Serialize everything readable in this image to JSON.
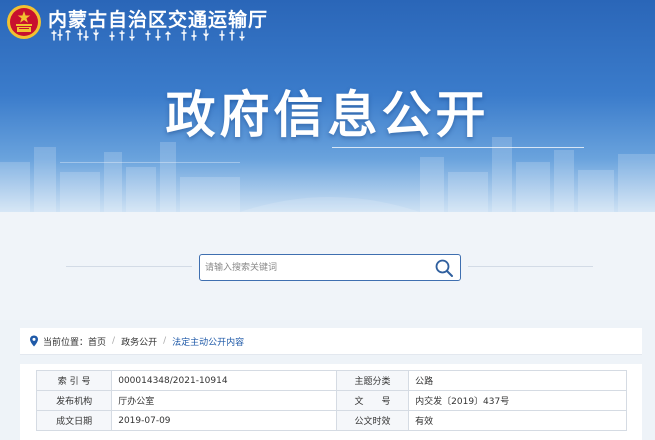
{
  "header": {
    "site_name": "内蒙古自治区交通运输厅",
    "hero_title": "政府信息公开"
  },
  "search": {
    "placeholder": "请输入搜索关键词",
    "icon": "search-icon"
  },
  "breadcrumb": {
    "prefix": "当前位置：",
    "items": [
      {
        "label": "首页"
      },
      {
        "label": "政务公开"
      },
      {
        "label": "法定主动公开内容"
      }
    ]
  },
  "info_table": {
    "rows": [
      {
        "label1": "索 引 号",
        "value1": "000014348/2021-10914",
        "label2": "主题分类",
        "value2": "公路"
      },
      {
        "label1": "发布机构",
        "value1": "厅办公室",
        "label2": "文　　号",
        "value2": "内交发〔2019〕437号"
      },
      {
        "label1": "成文日期",
        "value1": "2019-07-09",
        "label2": "公文时效",
        "value2": "有效"
      }
    ]
  },
  "colors": {
    "banner_top": "#2a66b8",
    "accent": "#1f5aa8",
    "emblem_red": "#c8102e",
    "emblem_gold": "#f2c230"
  }
}
